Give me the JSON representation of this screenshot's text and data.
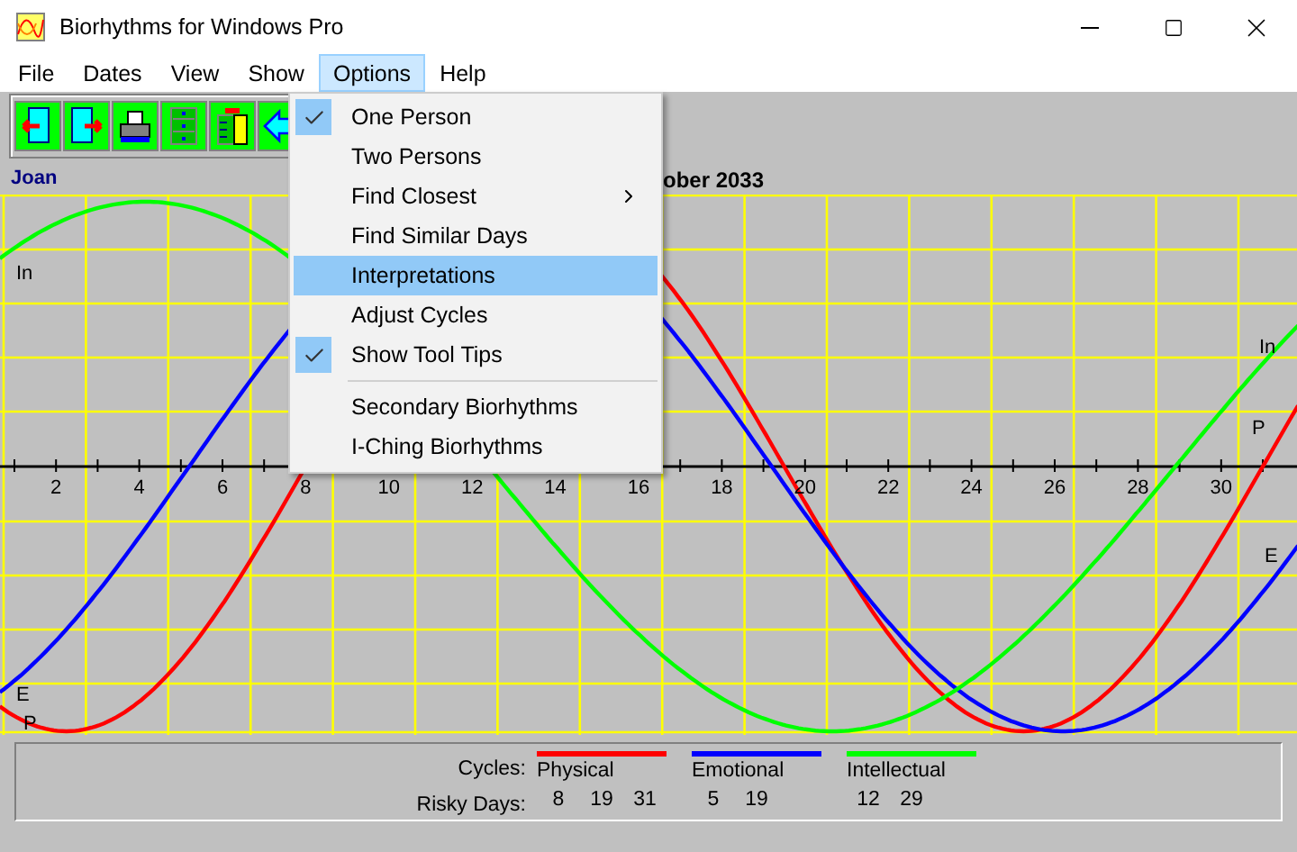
{
  "window": {
    "title": "Biorhythms for Windows Pro"
  },
  "menu_bar": [
    {
      "label": "File",
      "selected": false
    },
    {
      "label": "Dates",
      "selected": false
    },
    {
      "label": "View",
      "selected": false
    },
    {
      "label": "Show",
      "selected": false
    },
    {
      "label": "Options",
      "selected": true
    },
    {
      "label": "Help",
      "selected": false
    }
  ],
  "options_menu": [
    {
      "items": [
        {
          "label": "One Person",
          "checked": true,
          "selected": false,
          "submenu": false
        },
        {
          "label": "Two Persons",
          "checked": false,
          "selected": false,
          "submenu": false
        },
        {
          "label": "Find Closest",
          "checked": false,
          "selected": false,
          "submenu": true
        },
        {
          "label": "Find Similar Days",
          "checked": false,
          "selected": false,
          "submenu": false
        },
        {
          "label": "Interpretations",
          "checked": false,
          "selected": true,
          "submenu": false
        },
        {
          "label": "Adjust Cycles",
          "checked": false,
          "selected": false,
          "submenu": false
        },
        {
          "label": "Show Tool Tips",
          "checked": true,
          "selected": false,
          "submenu": false
        }
      ]
    },
    {
      "items": [
        {
          "label": "Secondary Biorhythms",
          "checked": false,
          "selected": false,
          "submenu": false
        },
        {
          "label": "I-Ching Biorhythms",
          "checked": false,
          "selected": false,
          "submenu": false
        }
      ]
    }
  ],
  "chart": {
    "person": "Joan",
    "title": "ober 2033",
    "day_ticks": [
      "2",
      "4",
      "6",
      "8",
      "10",
      "12",
      "14",
      "16",
      "18",
      "20",
      "22",
      "24",
      "26",
      "28",
      "30"
    ],
    "curve_labels_left": [
      "In",
      "E",
      "P"
    ],
    "curve_labels_right": [
      "In",
      "P",
      "E"
    ]
  },
  "legend": {
    "cycles_label": "Cycles:",
    "risky_label": "Risky Days:",
    "cycles": [
      {
        "name": "Physical",
        "color": "#ff0000",
        "risky_days": [
          "8",
          "19",
          "31"
        ]
      },
      {
        "name": "Emotional",
        "color": "#0000ff",
        "risky_days": [
          "5",
          "19"
        ]
      },
      {
        "name": "Intellectual",
        "color": "#00ff00",
        "risky_days": [
          "12",
          "29"
        ]
      }
    ]
  }
}
